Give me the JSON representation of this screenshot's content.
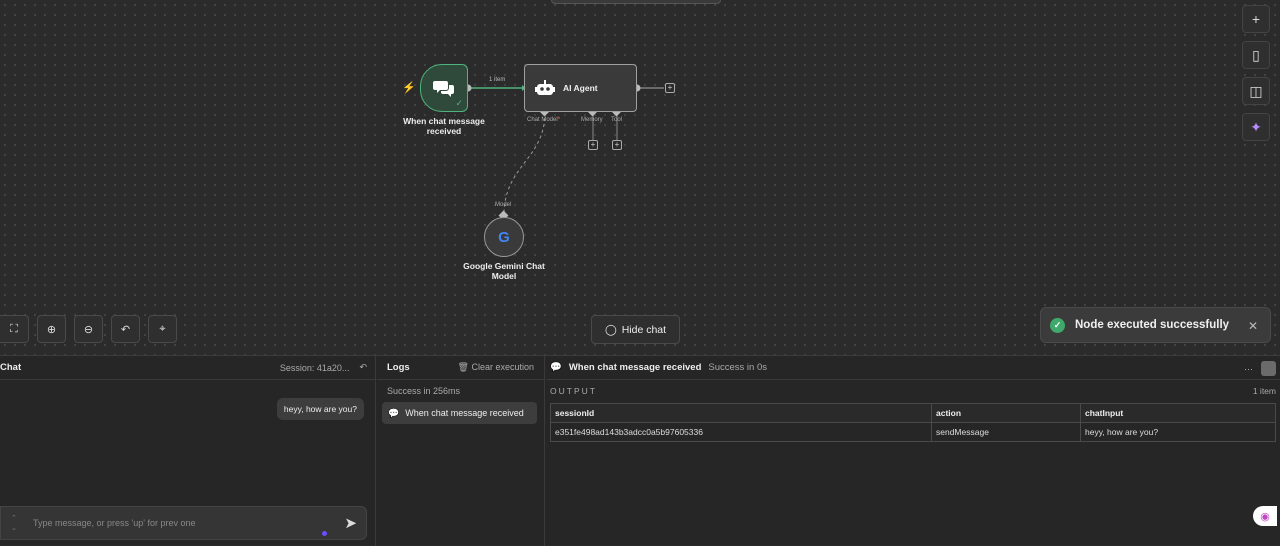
{
  "canvas": {
    "trigger_node": {
      "label": "When chat message received"
    },
    "edge_label": "1 item",
    "agent_node": {
      "title": "AI Agent"
    },
    "agent_ports": {
      "chat_model": "Chat Model",
      "memory": "Memory",
      "tool": "Tool"
    },
    "gemini_node": {
      "port": "Model",
      "label": "Google Gemini Chat Model",
      "logo": "G"
    },
    "hide_chat_label": "Hide chat"
  },
  "toast": {
    "message": "Node executed successfully"
  },
  "chat_panel": {
    "title": "Chat",
    "session": "Session: 41a20...",
    "messages": [
      {
        "text": "heyy, how are you?"
      }
    ],
    "input_placeholder": "Type message, or press 'up' for prev one"
  },
  "logs_panel": {
    "title": "Logs",
    "clear_label": "Clear execution",
    "status": "Success in 256ms",
    "items": [
      {
        "label": "When chat message received"
      }
    ]
  },
  "output_panel": {
    "node_name": "When chat message received",
    "status": "Success in 0s",
    "more": "···",
    "section": "OUTPUT",
    "items_count": "1 item",
    "columns": [
      "sessionId",
      "action",
      "chatInput"
    ],
    "row": [
      "e351fe498ad143b3adcc0a5b97605336",
      "sendMessage",
      "heyy, how are you?"
    ]
  }
}
